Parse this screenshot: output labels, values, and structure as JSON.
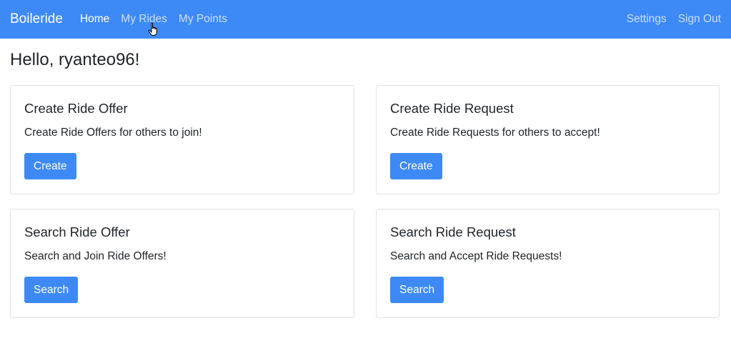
{
  "navbar": {
    "brand": "Boileride",
    "links": [
      "Home",
      "My Rides",
      "My Points"
    ],
    "right_links": [
      "Settings",
      "Sign Out"
    ],
    "color": "#3d8af7"
  },
  "greeting": "Hello, ryanteo96!",
  "cards": [
    {
      "title": "Create Ride Offer",
      "text": "Create Ride Offers for others to join!",
      "button": "Create"
    },
    {
      "title": "Create Ride Request",
      "text": "Create Ride Requests for others to accept!",
      "button": "Create"
    },
    {
      "title": "Search Ride Offer",
      "text": "Search and Join Ride Offers!",
      "button": "Search"
    },
    {
      "title": "Search Ride Request",
      "text": "Search and Accept Ride Requests!",
      "button": "Search"
    }
  ]
}
